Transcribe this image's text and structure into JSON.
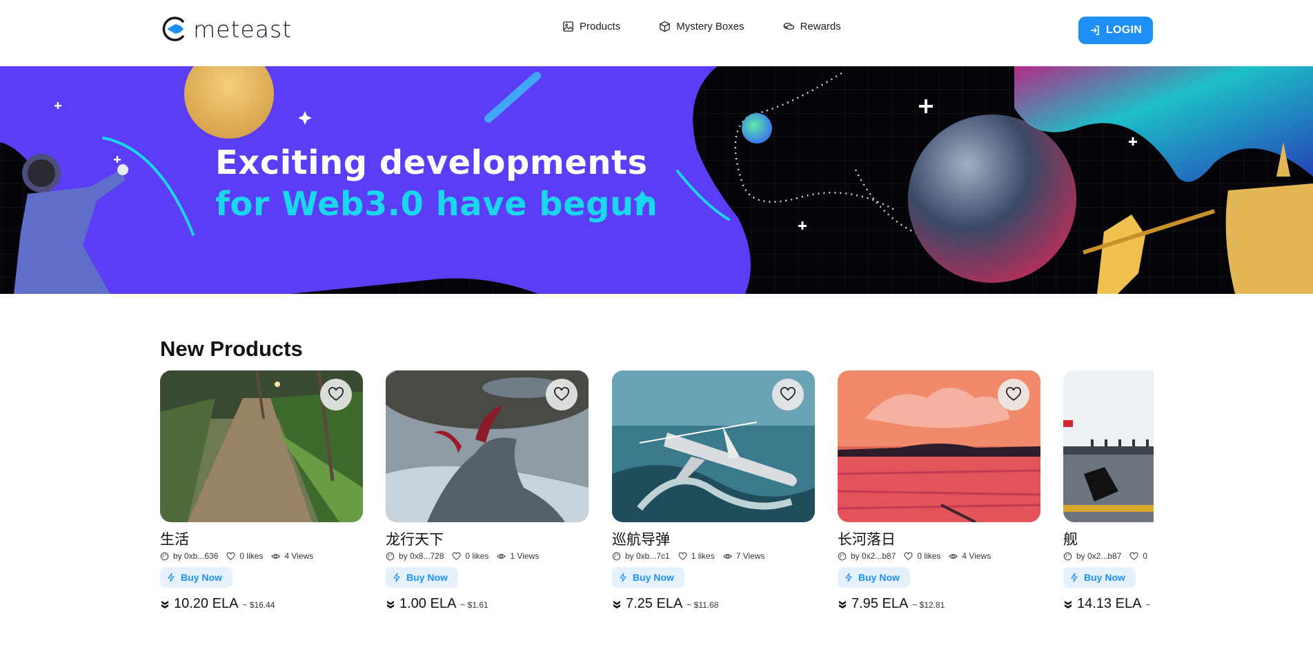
{
  "brand": {
    "name": "meteast"
  },
  "nav": {
    "items": [
      {
        "label": "Products",
        "icon": "image-icon"
      },
      {
        "label": "Mystery Boxes",
        "icon": "box-icon"
      },
      {
        "label": "Rewards",
        "icon": "coins-icon"
      }
    ]
  },
  "login": {
    "label": "LOGIN",
    "icon": "login-icon"
  },
  "banner": {
    "line1": "Exciting developments",
    "line2": "for Web3.0 have begun"
  },
  "section": {
    "title": "New Products"
  },
  "products": [
    {
      "name": "生活",
      "author": "by 0xb...636",
      "likes": "0 likes",
      "views": "4 Views",
      "buy": "Buy Now",
      "price": "10.20 ELA",
      "usd": "~ $16.44"
    },
    {
      "name": "龙行天下",
      "author": "by 0x8...728",
      "likes": "0 likes",
      "views": "1 Views",
      "buy": "Buy Now",
      "price": "1.00 ELA",
      "usd": "~ $1.61"
    },
    {
      "name": "巡航导弹",
      "author": "by 0xb...7c1",
      "likes": "1 likes",
      "views": "7 Views",
      "buy": "Buy Now",
      "price": "7.25 ELA",
      "usd": "~ $11.68"
    },
    {
      "name": "长河落日",
      "author": "by 0x2...b87",
      "likes": "0 likes",
      "views": "4 Views",
      "buy": "Buy Now",
      "price": "7.95 ELA",
      "usd": "~ $12.81"
    },
    {
      "name": "舰",
      "author": "by 0x2...b87",
      "likes": "0",
      "views": "",
      "buy": "Buy Now",
      "price": "14.13 ELA",
      "usd": "~"
    }
  ],
  "colors": {
    "accent": "#1d8ff5",
    "banner_cyan": "#1ad7ee",
    "banner_purple": "#5b3df5"
  }
}
